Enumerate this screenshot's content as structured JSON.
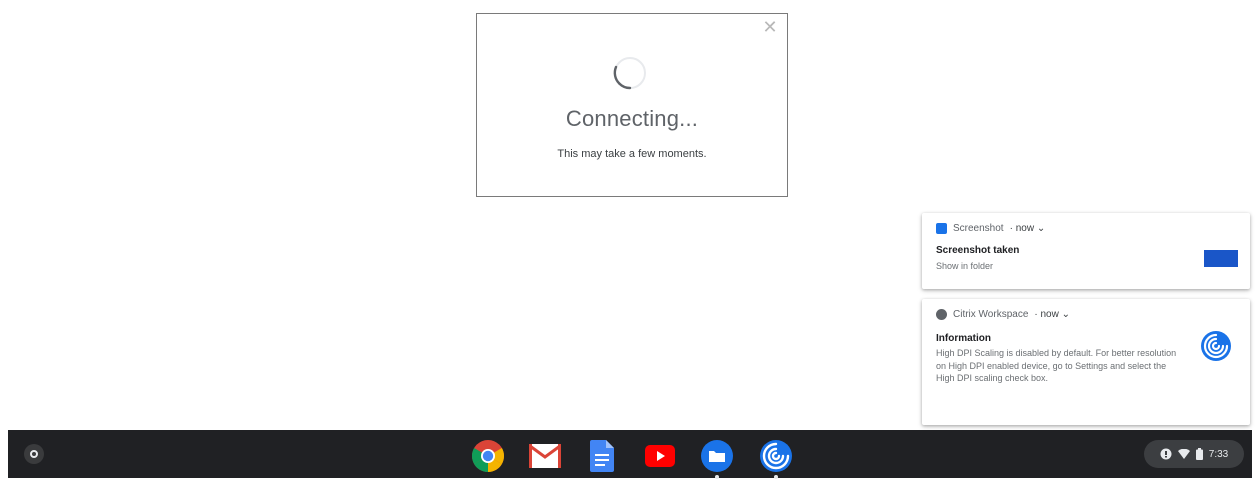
{
  "dialog": {
    "title": "Connecting...",
    "subtitle": "This may take a few moments.",
    "close_glyph": "✕"
  },
  "notifications": [
    {
      "app": "Screenshot",
      "time": "· now ⌄",
      "title": "Screenshot taken",
      "body": "Show in folder",
      "icon": "screenshot-icon",
      "accent": "#1a73e8"
    },
    {
      "app": "Citrix Workspace",
      "time": "· now ⌄",
      "title": "Information",
      "body": "High DPI Scaling is disabled by default. For better resolution on High DPI enabled device, go to Settings and select the High DPI scaling check box.",
      "icon": "citrix-icon",
      "accent": "#1a73e8"
    }
  ],
  "shelf": {
    "apps": [
      {
        "name": "chrome",
        "icon": "chrome-icon"
      },
      {
        "name": "gmail",
        "icon": "gmail-icon"
      },
      {
        "name": "docs",
        "icon": "docs-icon"
      },
      {
        "name": "youtube",
        "icon": "youtube-icon"
      },
      {
        "name": "files",
        "icon": "files-icon"
      },
      {
        "name": "citrix",
        "icon": "citrix-workspace-icon"
      }
    ],
    "tray": {
      "clock": "7:33"
    }
  }
}
